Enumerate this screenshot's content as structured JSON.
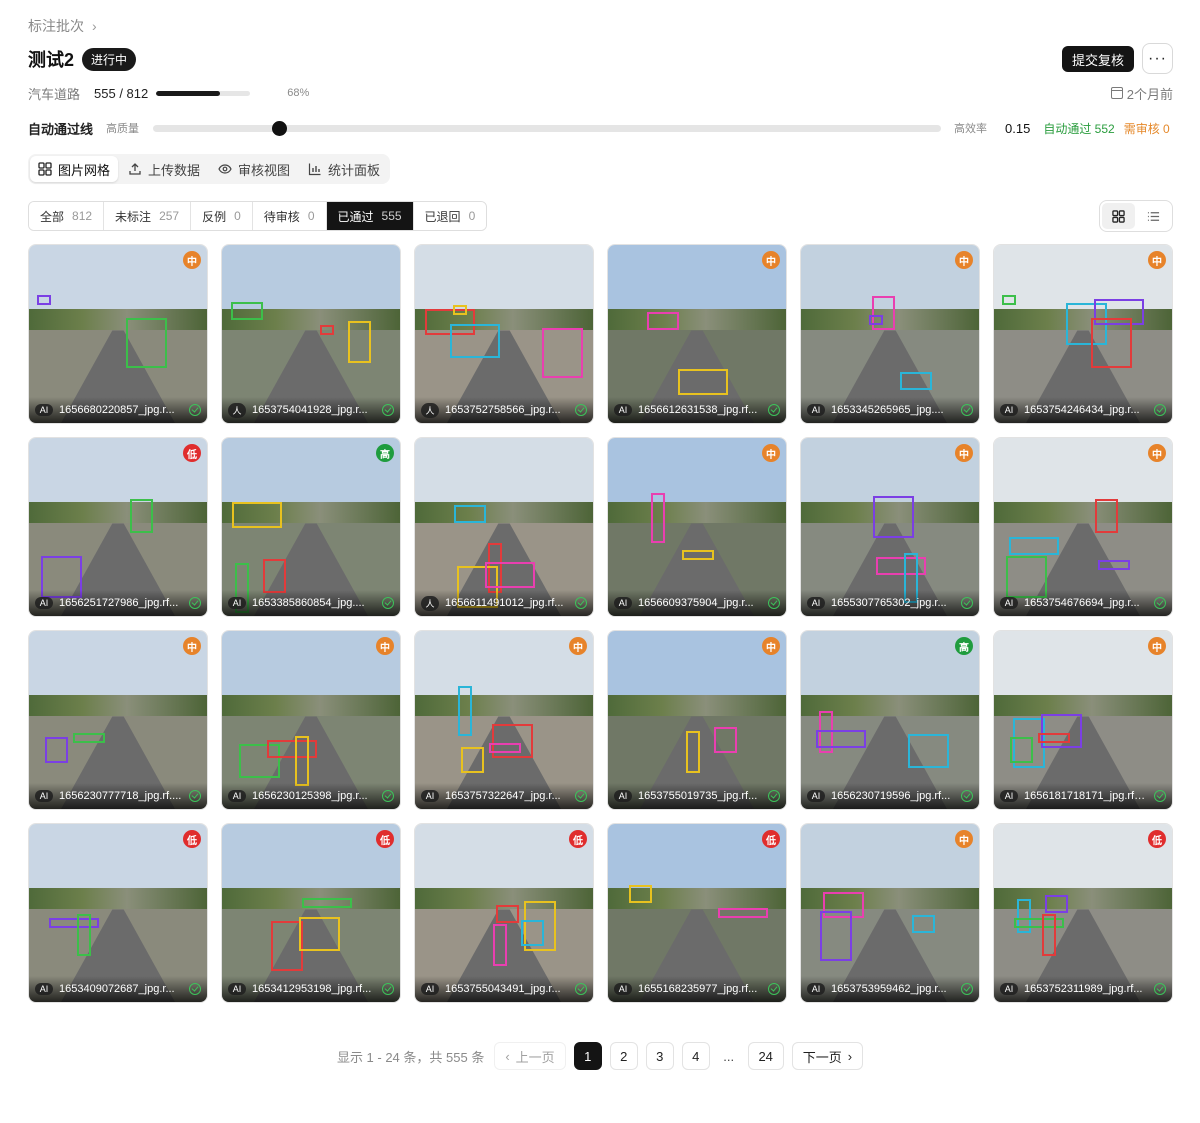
{
  "breadcrumb": {
    "label": "标注批次",
    "chevron": "›"
  },
  "header": {
    "title": "测试2",
    "status": "进行中",
    "submit_label": "提交复核",
    "more_label": "···"
  },
  "meta": {
    "category": "汽车道路",
    "count": "555 / 812",
    "progress": 0.68,
    "percent": "68%",
    "updated": "2个月前"
  },
  "threshold": {
    "label": "自动通过线",
    "low_label": "高质量",
    "high_label": "高效率",
    "value": "0.15",
    "slider_position": 0.16,
    "auto_pass": "自动通过 552",
    "need_review": "需审核 0"
  },
  "view_tabs": [
    {
      "label": "图片网格",
      "icon": "grid-icon",
      "active": true
    },
    {
      "label": "上传数据",
      "icon": "upload-icon",
      "active": false
    },
    {
      "label": "审核视图",
      "icon": "eye-icon",
      "active": false
    },
    {
      "label": "统计面板",
      "icon": "bar-chart-icon",
      "active": false
    }
  ],
  "filters": [
    {
      "label": "全部",
      "count": "812",
      "active": false
    },
    {
      "label": "未标注",
      "count": "257",
      "active": false
    },
    {
      "label": "反例",
      "count": "0",
      "active": false
    },
    {
      "label": "待审核",
      "count": "0",
      "active": false
    },
    {
      "label": "已通过",
      "count": "555",
      "active": true
    },
    {
      "label": "已退回",
      "count": "0",
      "active": false
    }
  ],
  "colors": {
    "accent": "#141414",
    "pass": "#2a9d3e",
    "review": "#e5892b",
    "grade_mid": "#e7832a",
    "grade_low": "#e02d2d",
    "grade_high": "#1f9c3e"
  },
  "images": [
    {
      "source": "AI",
      "name": "1656680220857_jpg.r...",
      "grade": "中",
      "level": "mid"
    },
    {
      "source": "人",
      "name": "1653754041928_jpg.r...",
      "grade": "",
      "level": ""
    },
    {
      "source": "人",
      "name": "1653752758566_jpg.r...",
      "grade": "",
      "level": ""
    },
    {
      "source": "AI",
      "name": "1656612631538_jpg.rf...",
      "grade": "中",
      "level": "mid"
    },
    {
      "source": "AI",
      "name": "1653345265965_jpg....",
      "grade": "中",
      "level": "mid"
    },
    {
      "source": "AI",
      "name": "1653754246434_jpg.r...",
      "grade": "中",
      "level": "mid"
    },
    {
      "source": "AI",
      "name": "1656251727986_jpg.rf...",
      "grade": "低",
      "level": "low"
    },
    {
      "source": "AI",
      "name": "1653385860854_jpg....",
      "grade": "高",
      "level": "high"
    },
    {
      "source": "人",
      "name": "1656611491012_jpg.rf...",
      "grade": "",
      "level": ""
    },
    {
      "source": "AI",
      "name": "1656609375904_jpg.r...",
      "grade": "中",
      "level": "mid"
    },
    {
      "source": "AI",
      "name": "1655307765302_jpg.r...",
      "grade": "中",
      "level": "mid"
    },
    {
      "source": "AI",
      "name": "1653754676694_jpg.r...",
      "grade": "中",
      "level": "mid"
    },
    {
      "source": "AI",
      "name": "1656230777718_jpg.rf....",
      "grade": "中",
      "level": "mid"
    },
    {
      "source": "AI",
      "name": "1656230125398_jpg.r...",
      "grade": "中",
      "level": "mid"
    },
    {
      "source": "AI",
      "name": "1653757322647_jpg.r...",
      "grade": "中",
      "level": "mid"
    },
    {
      "source": "AI",
      "name": "1653755019735_jpg.rf...",
      "grade": "中",
      "level": "mid"
    },
    {
      "source": "AI",
      "name": "1656230719596_jpg.rf...",
      "grade": "高",
      "level": "high"
    },
    {
      "source": "AI",
      "name": "1656181718171_jpg.rf.cf...",
      "grade": "中",
      "level": "mid"
    },
    {
      "source": "AI",
      "name": "1653409072687_jpg.r...",
      "grade": "低",
      "level": "low"
    },
    {
      "source": "AI",
      "name": "1653412953198_jpg.rf...",
      "grade": "低",
      "level": "low"
    },
    {
      "source": "AI",
      "name": "1653755043491_jpg.r...",
      "grade": "低",
      "level": "low"
    },
    {
      "source": "AI",
      "name": "1655168235977_jpg.rf...",
      "grade": "低",
      "level": "low"
    },
    {
      "source": "AI",
      "name": "1653753959462_jpg.r...",
      "grade": "中",
      "level": "mid"
    },
    {
      "source": "AI",
      "name": "1653752311989_jpg.rf...",
      "grade": "低",
      "level": "low"
    }
  ],
  "pagination": {
    "info": "显示 1 - 24 条，共 555 条",
    "prev_label": "上一页",
    "next_label": "下一页",
    "pages": [
      "1",
      "2",
      "3",
      "4",
      "...",
      "24"
    ],
    "current": "1"
  }
}
